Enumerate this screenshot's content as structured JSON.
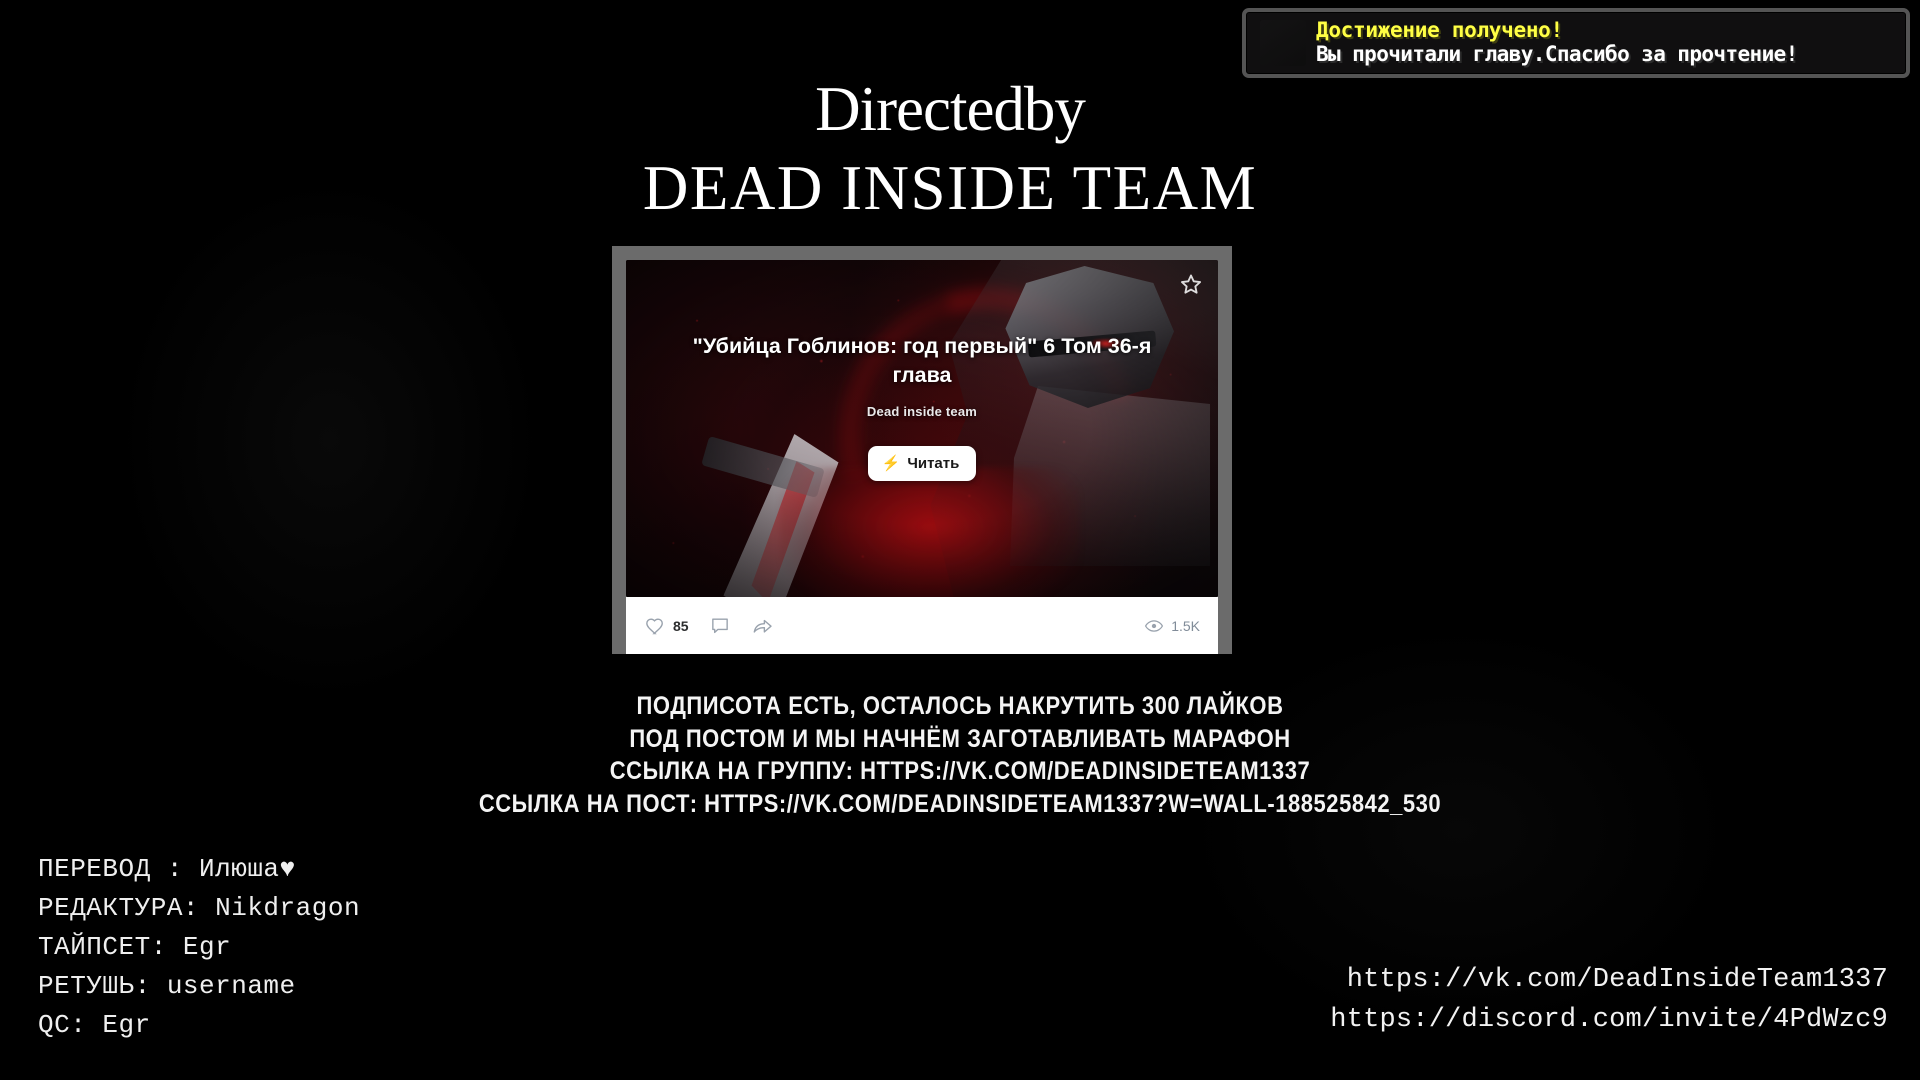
{
  "achievement": {
    "title": "Достижение получено!",
    "description": "Вы прочитали главу.Спасибо за прочтение!",
    "title_color": "#ffff44",
    "description_color": "#ffffff",
    "panel_bg": "#100f10",
    "panel_border": "#545454"
  },
  "heading": {
    "line_1": "Directedby",
    "line_2": "DEAD INSIDE TEAM"
  },
  "post": {
    "title": "\"Убийца Гоблинов: год первый\" 6 Том 36-я глава",
    "subtitle": "Dead inside team",
    "read_button": "Читать",
    "bolt_glyph": "⚡",
    "star_icon": "star-outline-icon",
    "likes": "85",
    "comment_icon": "comment-icon",
    "share_icon": "share-icon",
    "views_icon": "eye-icon",
    "views": "1.5K",
    "card_border_color": "#6b6b6b",
    "action_bar_bg": "#ffffff",
    "like_count_color": "#2c2d2e",
    "views_color": "#818c99"
  },
  "promo": {
    "lines": [
      "ПОДПИСОТА ЕСТЬ, ОСТАЛОСЬ НАКРУТИТЬ 300 ЛАЙКОВ",
      "ПОД ПОСТОМ И МЫ НАЧНЁМ ЗАГОТАВЛИВАТЬ МАРАФОН",
      "ССЫЛКА НА ГРУППУ:  HTTPS://VK.COM/DEADINSIDETEAM1337",
      "ССЫЛКА НА ПОСТ:  HTTPS://VK.COM/DEADINSIDETEAM1337?W=WALL-188525842_530"
    ]
  },
  "credits": {
    "lines": [
      "ПЕРЕВОД :  Илюша♥",
      "РЕДАКТУРА: Nikdragon",
      "ТАЙПСЕТ: Egr",
      "РЕТУШЬ: username",
      "QC: Egr"
    ]
  },
  "links": {
    "vk": "https://vk.com/DeadInsideTeam1337",
    "discord": "https://discord.com/invite/4PdWzc9"
  }
}
